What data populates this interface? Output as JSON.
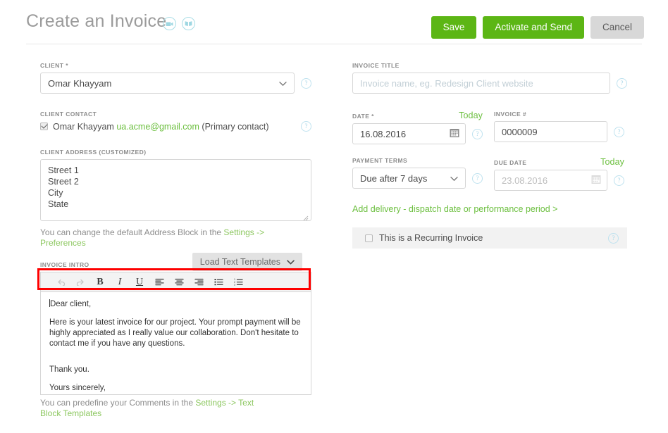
{
  "header": {
    "title": "Create an Invoice",
    "icons": [
      {
        "name": "video-camera-icon",
        "label": "video"
      },
      {
        "name": "guide-book-icon",
        "label": "guide"
      }
    ],
    "buttons": {
      "save": "Save",
      "activate_send": "Activate and Send",
      "cancel": "Cancel"
    },
    "colors": {
      "green": "#5cb615",
      "gray": "#d8d8d8",
      "title": "#9b9b9b",
      "icon_teal": "#9ed7e2"
    }
  },
  "left": {
    "client": {
      "label": "CLIENT *",
      "value": "Omar Khayyam",
      "help": "?"
    },
    "client_contact": {
      "label": "CLIENT CONTACT",
      "checked": true,
      "name": "Omar Khayyam",
      "email": "ua.acme@gmail.com",
      "suffix": "(Primary contact)",
      "help": "?"
    },
    "client_address": {
      "label": "CLIENT ADDRESS (CUSTOMIZED)",
      "value": "Street 1\nStreet 2\nCity\nState",
      "hint_before": "You can change the default Address Block in the ",
      "hint_link": "Settings -> Preferences"
    },
    "invoice_intro": {
      "label": "INVOICE INTRO",
      "load_templates": "Load Text Templates",
      "toolbar": [
        {
          "name": "undo-icon",
          "glyph": "↶",
          "muted": true
        },
        {
          "name": "redo-icon",
          "glyph": "↷",
          "muted": true
        },
        {
          "name": "bold-icon",
          "glyph": "B",
          "muted": false
        },
        {
          "name": "italic-icon",
          "glyph": "I",
          "muted": false
        },
        {
          "name": "underline-icon",
          "glyph": "U",
          "muted": false
        },
        {
          "name": "align-left-icon",
          "glyph": "",
          "muted": false
        },
        {
          "name": "align-center-icon",
          "glyph": "",
          "muted": false
        },
        {
          "name": "align-right-icon",
          "glyph": "",
          "muted": false
        },
        {
          "name": "bulleted-list-icon",
          "glyph": "",
          "muted": false
        },
        {
          "name": "numbered-list-icon",
          "glyph": "",
          "muted": false
        }
      ],
      "body": {
        "p1": "Dear client,",
        "p2": "Here is your latest invoice for our project. Your prompt payment will be highly appreciated as I really value our collaboration. Don't hesitate to contact me if you have any questions.",
        "p3": "Thank you.",
        "p4": "Yours sincerely,"
      },
      "hint_before": "You can predefine your Comments in the ",
      "hint_link": "Settings -> Text Block Templates"
    }
  },
  "right": {
    "invoice_title": {
      "label": "INVOICE TITLE",
      "value": "",
      "placeholder": "Invoice name, eg. Redesign Client website",
      "help": "?"
    },
    "date": {
      "label": "DATE *",
      "today_link": "Today",
      "value": "16.08.2016",
      "help": "?"
    },
    "invoice_number": {
      "label": "INVOICE #",
      "value": "0000009",
      "help": "?"
    },
    "payment_terms": {
      "label": "PAYMENT TERMS",
      "value": "Due after 7 days",
      "help": "?"
    },
    "due_date": {
      "label": "DUE DATE",
      "today_link": "Today",
      "value": "23.08.2016",
      "disabled": true,
      "help": "?"
    },
    "add_delivery_link": "Add delivery - dispatch date or performance period >",
    "recurring": {
      "label": "This is a Recurring Invoice",
      "checked": false,
      "help": "?"
    }
  },
  "annotation": {
    "name": "red-highlight-box",
    "color": "#fe0000",
    "target": "rich-text-toolbar"
  }
}
